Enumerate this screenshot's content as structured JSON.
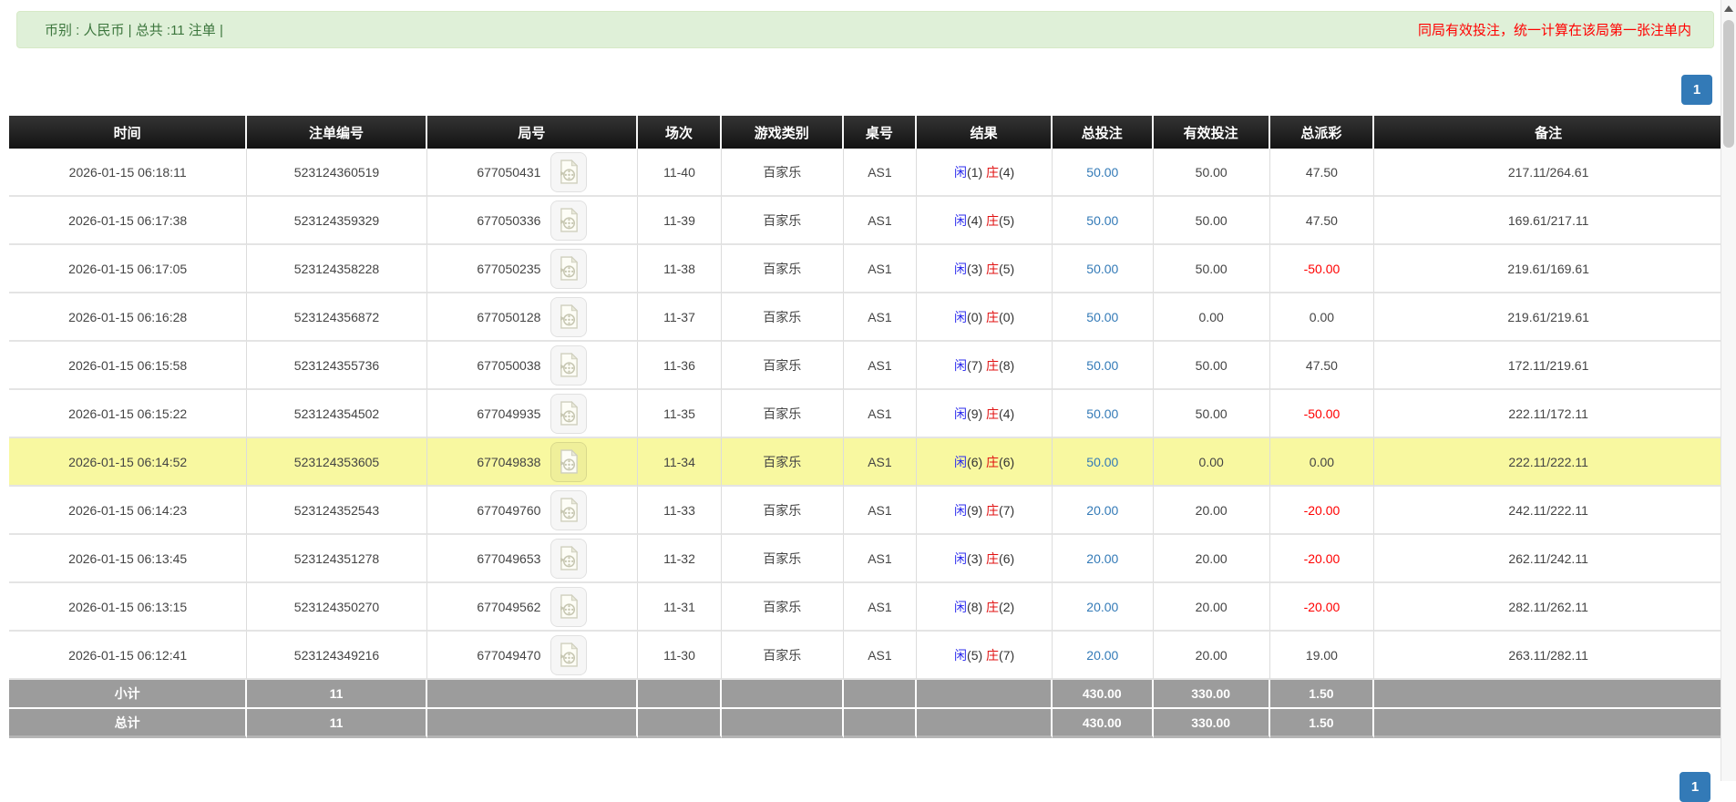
{
  "notice_bar": {
    "summary": "币别 : 人民币 | 总共 :11 注单 |",
    "note": "同局有效投注，统一计算在该局第一张注单内"
  },
  "pagination": {
    "current_page": "1"
  },
  "colors": {
    "notice_bg": "#dff0d8",
    "notice_text": "#3c763d",
    "note_red": "#ff0000",
    "header_bg": "#1c1c1c",
    "link_blue": "#337ab7",
    "player_blue": "#2b2bee",
    "banker_red": "#e01212",
    "negative_red": "#ff0000",
    "highlight_yellow": "#f8f8a0",
    "summary_gray": "#9c9c9c"
  },
  "table": {
    "columns": [
      {
        "key": "time",
        "label": "时间",
        "width": "13.9%"
      },
      {
        "key": "bet_id",
        "label": "注单编号",
        "width": "10.5%"
      },
      {
        "key": "round_no",
        "label": "局号",
        "width": "12.3%"
      },
      {
        "key": "session",
        "label": "场次",
        "width": "4.9%"
      },
      {
        "key": "game",
        "label": "游戏类别",
        "width": "7.1%"
      },
      {
        "key": "table_no",
        "label": "桌号",
        "width": "4.3%"
      },
      {
        "key": "result",
        "label": "结果",
        "width": "7.9%"
      },
      {
        "key": "total_bet",
        "label": "总投注",
        "width": "5.9%"
      },
      {
        "key": "valid_bet",
        "label": "有效投注",
        "width": "6.8%"
      },
      {
        "key": "payout",
        "label": "总派彩",
        "width": "6.1%"
      },
      {
        "key": "remark",
        "label": "备注",
        "width": "20.3%"
      }
    ],
    "result_labels": {
      "player": "闲",
      "banker": "庄"
    },
    "rows": [
      {
        "time": "2026-01-15 06:18:11",
        "bet_id": "523124360519",
        "round_no": "677050431",
        "session": "11-40",
        "game": "百家乐",
        "table_no": "AS1",
        "player_score": "(1)",
        "banker_score": "(4)",
        "total_bet": "50.00",
        "valid_bet": "50.00",
        "payout": "47.50",
        "remark": "217.11/264.61",
        "highlight": false
      },
      {
        "time": "2026-01-15 06:17:38",
        "bet_id": "523124359329",
        "round_no": "677050336",
        "session": "11-39",
        "game": "百家乐",
        "table_no": "AS1",
        "player_score": "(4)",
        "banker_score": "(5)",
        "total_bet": "50.00",
        "valid_bet": "50.00",
        "payout": "47.50",
        "remark": "169.61/217.11",
        "highlight": false
      },
      {
        "time": "2026-01-15 06:17:05",
        "bet_id": "523124358228",
        "round_no": "677050235",
        "session": "11-38",
        "game": "百家乐",
        "table_no": "AS1",
        "player_score": "(3)",
        "banker_score": "(5)",
        "total_bet": "50.00",
        "valid_bet": "50.00",
        "payout": "-50.00",
        "remark": "219.61/169.61",
        "highlight": false
      },
      {
        "time": "2026-01-15 06:16:28",
        "bet_id": "523124356872",
        "round_no": "677050128",
        "session": "11-37",
        "game": "百家乐",
        "table_no": "AS1",
        "player_score": "(0)",
        "banker_score": "(0)",
        "total_bet": "50.00",
        "valid_bet": "0.00",
        "payout": "0.00",
        "remark": "219.61/219.61",
        "highlight": false
      },
      {
        "time": "2026-01-15 06:15:58",
        "bet_id": "523124355736",
        "round_no": "677050038",
        "session": "11-36",
        "game": "百家乐",
        "table_no": "AS1",
        "player_score": "(7)",
        "banker_score": "(8)",
        "total_bet": "50.00",
        "valid_bet": "50.00",
        "payout": "47.50",
        "remark": "172.11/219.61",
        "highlight": false
      },
      {
        "time": "2026-01-15 06:15:22",
        "bet_id": "523124354502",
        "round_no": "677049935",
        "session": "11-35",
        "game": "百家乐",
        "table_no": "AS1",
        "player_score": "(9)",
        "banker_score": "(4)",
        "total_bet": "50.00",
        "valid_bet": "50.00",
        "payout": "-50.00",
        "remark": "222.11/172.11",
        "highlight": false
      },
      {
        "time": "2026-01-15 06:14:52",
        "bet_id": "523124353605",
        "round_no": "677049838",
        "session": "11-34",
        "game": "百家乐",
        "table_no": "AS1",
        "player_score": "(6)",
        "banker_score": "(6)",
        "total_bet": "50.00",
        "valid_bet": "0.00",
        "payout": "0.00",
        "remark": "222.11/222.11",
        "highlight": true
      },
      {
        "time": "2026-01-15 06:14:23",
        "bet_id": "523124352543",
        "round_no": "677049760",
        "session": "11-33",
        "game": "百家乐",
        "table_no": "AS1",
        "player_score": "(9)",
        "banker_score": "(7)",
        "total_bet": "20.00",
        "valid_bet": "20.00",
        "payout": "-20.00",
        "remark": "242.11/222.11",
        "highlight": false
      },
      {
        "time": "2026-01-15 06:13:45",
        "bet_id": "523124351278",
        "round_no": "677049653",
        "session": "11-32",
        "game": "百家乐",
        "table_no": "AS1",
        "player_score": "(3)",
        "banker_score": "(6)",
        "total_bet": "20.00",
        "valid_bet": "20.00",
        "payout": "-20.00",
        "remark": "262.11/242.11",
        "highlight": false
      },
      {
        "time": "2026-01-15 06:13:15",
        "bet_id": "523124350270",
        "round_no": "677049562",
        "session": "11-31",
        "game": "百家乐",
        "table_no": "AS1",
        "player_score": "(8)",
        "banker_score": "(2)",
        "total_bet": "20.00",
        "valid_bet": "20.00",
        "payout": "-20.00",
        "remark": "282.11/262.11",
        "highlight": false
      },
      {
        "time": "2026-01-15 06:12:41",
        "bet_id": "523124349216",
        "round_no": "677049470",
        "session": "11-30",
        "game": "百家乐",
        "table_no": "AS1",
        "player_score": "(5)",
        "banker_score": "(7)",
        "total_bet": "20.00",
        "valid_bet": "20.00",
        "payout": "19.00",
        "remark": "263.11/282.11",
        "highlight": false
      }
    ],
    "footer_rows": [
      {
        "label": "小计",
        "count": "11",
        "total_bet": "430.00",
        "valid_bet": "330.00",
        "payout": "1.50"
      },
      {
        "label": "总计",
        "count": "11",
        "total_bet": "430.00",
        "valid_bet": "330.00",
        "payout": "1.50"
      }
    ]
  }
}
